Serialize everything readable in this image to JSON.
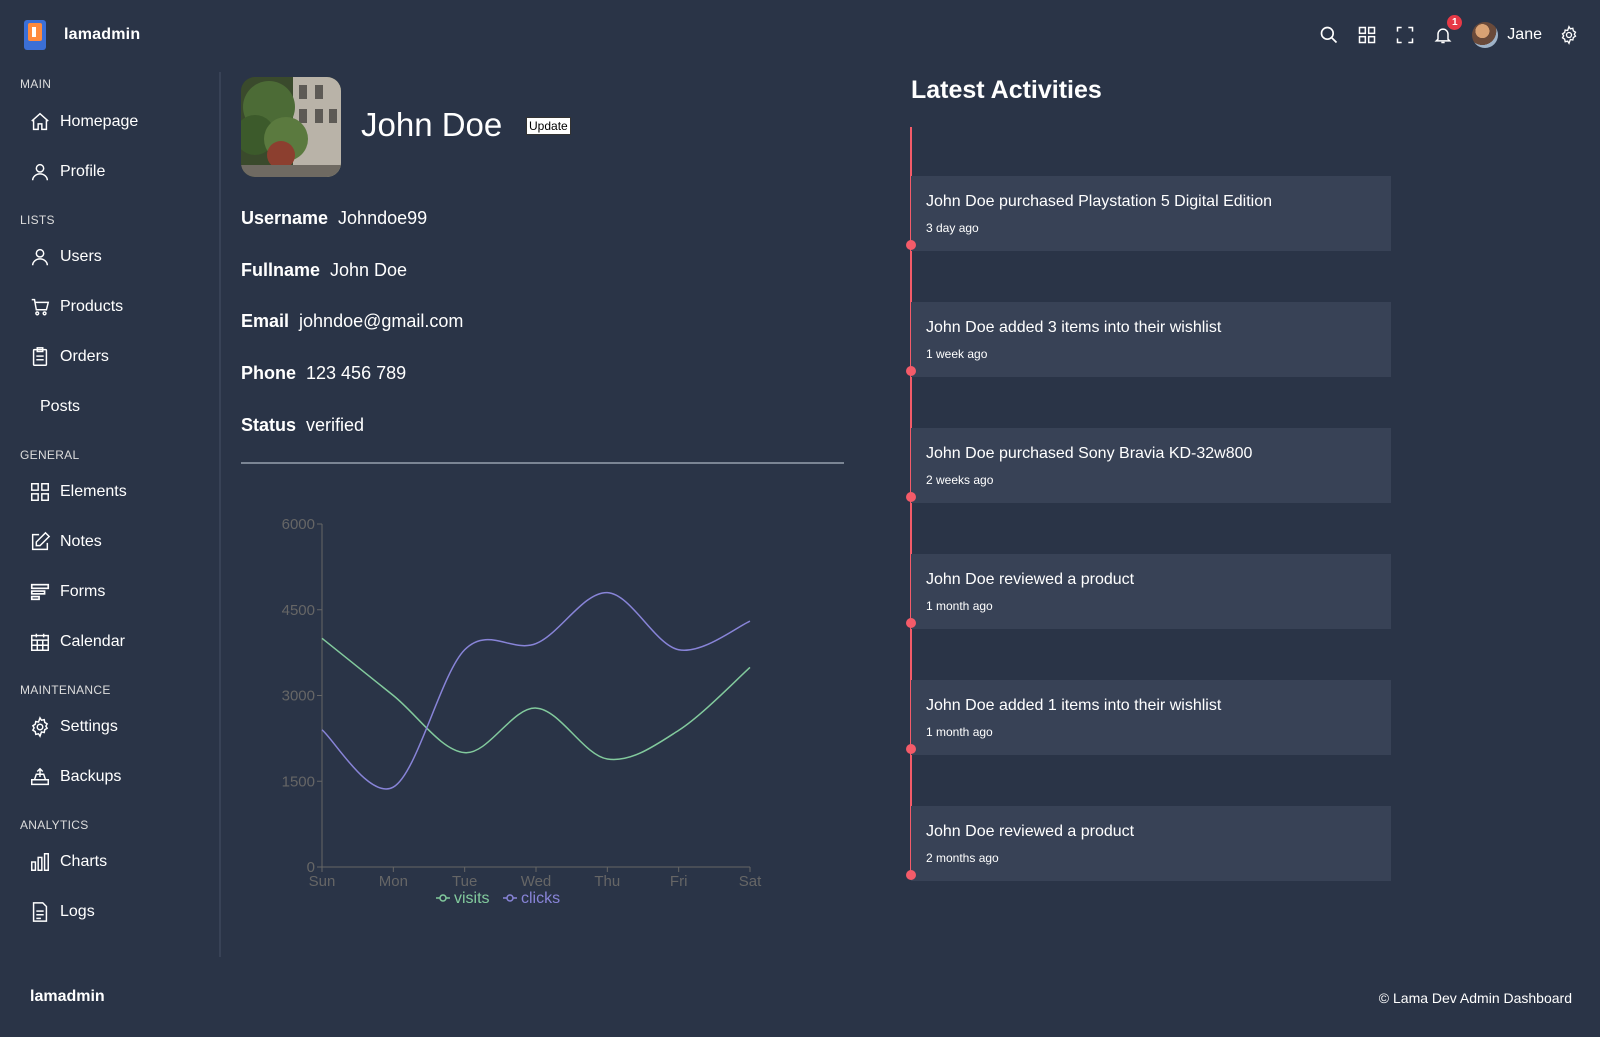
{
  "brand": {
    "name": "lamadmin"
  },
  "navbar": {
    "notifications_count": "1",
    "user_name": "Jane"
  },
  "sidebar": {
    "sections": [
      {
        "title": "MAIN",
        "items": [
          "Homepage",
          "Profile"
        ]
      },
      {
        "title": "LISTS",
        "items": [
          "Users",
          "Products",
          "Orders",
          "Posts"
        ]
      },
      {
        "title": "GENERAL",
        "items": [
          "Elements",
          "Notes",
          "Forms",
          "Calendar"
        ]
      },
      {
        "title": "MAINTENANCE",
        "items": [
          "Settings",
          "Backups"
        ]
      },
      {
        "title": "ANALYTICS",
        "items": [
          "Charts",
          "Logs"
        ]
      }
    ]
  },
  "profile": {
    "name": "John Doe",
    "update_label": "Update",
    "details": [
      {
        "key": "Username",
        "value": "Johndoe99"
      },
      {
        "key": "Fullname",
        "value": "John Doe"
      },
      {
        "key": "Email",
        "value": "johndoe@gmail.com"
      },
      {
        "key": "Phone",
        "value": "123 456 789"
      },
      {
        "key": "Status",
        "value": "verified"
      }
    ]
  },
  "chart_data": {
    "type": "line",
    "categories": [
      "Sun",
      "Mon",
      "Tue",
      "Wed",
      "Thu",
      "Fri",
      "Sat"
    ],
    "series": [
      {
        "name": "visits",
        "color": "#82ca9d",
        "values": [
          4000,
          3000,
          2000,
          2780,
          1890,
          2390,
          3490
        ]
      },
      {
        "name": "clicks",
        "color": "#8884d8",
        "values": [
          2400,
          1398,
          3800,
          3908,
          4800,
          3800,
          4300
        ]
      }
    ],
    "yticks": [
      0,
      1500,
      3000,
      4500,
      6000
    ],
    "ylim": [
      0,
      6000
    ],
    "legend": "bottom-center",
    "grid": false
  },
  "activities": {
    "title": "Latest Activities",
    "items": [
      {
        "text": "John Doe purchased Playstation 5 Digital Edition",
        "when": "3 day ago"
      },
      {
        "text": "John Doe added 3 items into their wishlist",
        "when": "1 week ago"
      },
      {
        "text": "John Doe purchased Sony Bravia KD-32w800",
        "when": "2 weeks ago"
      },
      {
        "text": "John Doe reviewed a product",
        "when": "1 month ago"
      },
      {
        "text": "John Doe added 1 items into their wishlist",
        "when": "1 month ago"
      },
      {
        "text": "John Doe reviewed a product",
        "when": "2 months ago"
      }
    ]
  },
  "footer": {
    "brand": "lamadmin",
    "copyright": "© Lama Dev Admin Dashboard"
  }
}
